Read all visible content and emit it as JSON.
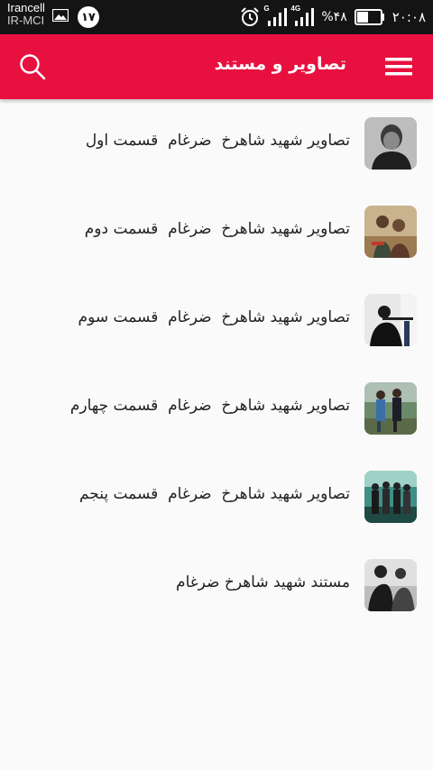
{
  "status_bar": {
    "carrier_name": "Irancell",
    "carrier_sub": "IR-MCI",
    "notification_count": "۱۷",
    "network_g": "G",
    "network_4g": "4G",
    "battery_percent": "%۴۸",
    "time": "۲۰:۰۸",
    "icons": [
      "image-icon",
      "alarm-icon",
      "signal-icon",
      "battery-icon"
    ]
  },
  "app_bar": {
    "title": "تصاویر و مستند",
    "color": "#e8103f",
    "icons": [
      "search-icon",
      "menu-icon"
    ]
  },
  "list": {
    "items": [
      {
        "label": "تصاویر شهید شاهرخ  ضرغام  قسمت اول"
      },
      {
        "label": "تصاویر شهید شاهرخ  ضرغام  قسمت دوم"
      },
      {
        "label": "تصاویر شهید شاهرخ  ضرغام  قسمت سوم"
      },
      {
        "label": "تصاویر شهید شاهرخ  ضرغام  قسمت چهارم"
      },
      {
        "label": "تصاویر شهید شاهرخ  ضرغام  قسمت پنجم"
      },
      {
        "label": "مستند شهید شاهرخ ضرغام"
      }
    ]
  }
}
